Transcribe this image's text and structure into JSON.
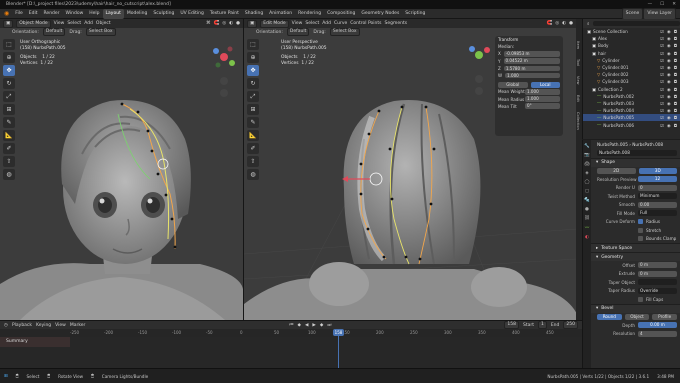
{
  "window": {
    "title": "Blender* [D:\\_project files\\2023\\udemy\\hair\\hair_no_cutscript\\alex.blend]",
    "controls": [
      "—",
      "☐",
      "✕"
    ]
  },
  "menubar": {
    "menus": [
      "File",
      "Edit",
      "Render",
      "Window",
      "Help"
    ],
    "workspaces": [
      "Layout",
      "Modeling",
      "Sculpting",
      "UV Editing",
      "Texture Paint",
      "Shading",
      "Animation",
      "Rendering",
      "Compositing",
      "Geometry Nodes",
      "Scripting"
    ],
    "active_workspace": "Layout",
    "scene": "Scene",
    "view_layer": "View Layer"
  },
  "left_viewport": {
    "mode": "Object Mode",
    "menus": [
      "View",
      "Select",
      "Add",
      "Object"
    ],
    "orientation_label": "Orientation:",
    "orientation_value": "Default",
    "drag_label": "Drag:",
    "drag_value": "Select Box",
    "overlay_title": "User Orthographic",
    "overlay_object": "(158) NurbsPath.005",
    "stats_objects_label": "Objects",
    "stats_objects_value": "1 / 22",
    "stats_vertices_label": "Vertices",
    "stats_vertices_value": "1 / 22"
  },
  "right_viewport": {
    "mode": "Edit Mode",
    "menus": [
      "View",
      "Select",
      "Add",
      "Curve",
      "Control Points",
      "Segments"
    ],
    "orientation_label": "Orientation:",
    "orientation_value": "Default",
    "drag_label": "Drag:",
    "drag_value": "Select Box",
    "overlay_title": "User Perspective",
    "overlay_object": "(158) NurbsPath.005",
    "stats_objects_label": "Objects",
    "stats_objects_value": "1 / 22",
    "stats_vertices_label": "Vertices",
    "stats_vertices_value": "1 / 22"
  },
  "n_panel": {
    "title": "Transform",
    "median_label": "Median:",
    "x_label": "X",
    "x_value": "-0.09853 m",
    "y_label": "Y",
    "y_value": "0.04522 m",
    "z_label": "Z",
    "z_value": "1.5780 m",
    "w_label": "W",
    "w_value": "1.000",
    "global_label": "Global",
    "local_label": "Local",
    "weight_label": "Mean Weight",
    "weight_value": "1.000",
    "radius_label": "Mean Radius",
    "radius_value": "1.000",
    "tilt_label": "Mean Tilt",
    "tilt_value": "0°",
    "side_tabs": [
      "Item",
      "Tool",
      "View",
      "Edit",
      "Collection"
    ]
  },
  "outliner": {
    "title": "Scene Collection",
    "rows": [
      {
        "name": "Scene Collection",
        "indent": 0,
        "selected": false
      },
      {
        "name": "Alex",
        "indent": 1,
        "selected": false
      },
      {
        "name": "Body",
        "indent": 1,
        "selected": false
      },
      {
        "name": "hair",
        "indent": 1,
        "selected": false
      },
      {
        "name": "Cylinder",
        "indent": 2,
        "selected": false
      },
      {
        "name": "Cylinder.001",
        "indent": 2,
        "selected": false
      },
      {
        "name": "Cylinder.002",
        "indent": 2,
        "selected": false
      },
      {
        "name": "Cylinder.003",
        "indent": 2,
        "selected": false
      },
      {
        "name": "Collection 2",
        "indent": 1,
        "selected": false
      },
      {
        "name": "NurbsPath.002",
        "indent": 2,
        "selected": false
      },
      {
        "name": "NurbsPath.003",
        "indent": 2,
        "selected": false
      },
      {
        "name": "NurbsPath.004",
        "indent": 2,
        "selected": false
      },
      {
        "name": "NurbsPath.005",
        "indent": 2,
        "selected": true
      },
      {
        "name": "NurbsPath.006",
        "indent": 2,
        "selected": false
      }
    ]
  },
  "properties": {
    "breadcrumb": "NurbsPath.005  ›  NurbsPath.008",
    "datablock": "NurbsPath.008",
    "shape_header": "Shape",
    "dim_2d": "2D",
    "dim_3d": "3D",
    "res_preview_label": "Resolution Preview U",
    "res_preview_value": "12",
    "render_u_label": "Render U",
    "render_u_value": "0",
    "twist_method_label": "Twist Method",
    "twist_method_value": "Minimum",
    "smooth_label": "Smooth",
    "smooth_value": "0.00",
    "fill_mode_label": "Fill Mode",
    "fill_mode_value": "Full",
    "curve_deform_label": "Curve Deform",
    "radius_label": "Radius",
    "stretch_label": "Stretch",
    "bounds_clamp_label": "Bounds Clamp",
    "texture_space_header": "Texture Space",
    "geometry_header": "Geometry",
    "offset_label": "Offset",
    "offset_value": "0 m",
    "extrude_label": "Extrude",
    "extrude_value": "0 m",
    "taper_object_label": "Taper Object",
    "taper_radius_label": "Taper Radius",
    "taper_radius_value": "Override",
    "fill_caps_label": "Fill Caps",
    "bevel_header": "Bevel",
    "bevel_round": "Round",
    "bevel_object": "Object",
    "bevel_profile": "Profile",
    "depth_label": "Depth",
    "depth_value": "0.00 m",
    "resolution_label": "Resolution",
    "resolution_value": "4"
  },
  "timeline": {
    "menus": [
      "Playback",
      "Keying",
      "View",
      "Marker"
    ],
    "summary_label": "Summary",
    "current_frame": "158",
    "start_label": "Start",
    "start_value": "1",
    "end_label": "End",
    "end_value": "250",
    "ticks": [
      "-250",
      "-200",
      "-150",
      "-100",
      "-50",
      "0",
      "50",
      "100",
      "150",
      "200",
      "250",
      "300",
      "350",
      "400",
      "450"
    ]
  },
  "taskbar": {
    "items": [
      "Select",
      "Rotate View",
      "Camera Lights/Bundle"
    ],
    "status": "NurbsPath.005 | Verts 1/22 | Objects 1/22 | 3.6.1",
    "clock": "3:48 PM"
  },
  "colors": {
    "accent": "#4772b3",
    "selected_row": "#334d80",
    "viewport_bg": "#3c3c3c",
    "panel_bg": "#2b2b2b"
  }
}
